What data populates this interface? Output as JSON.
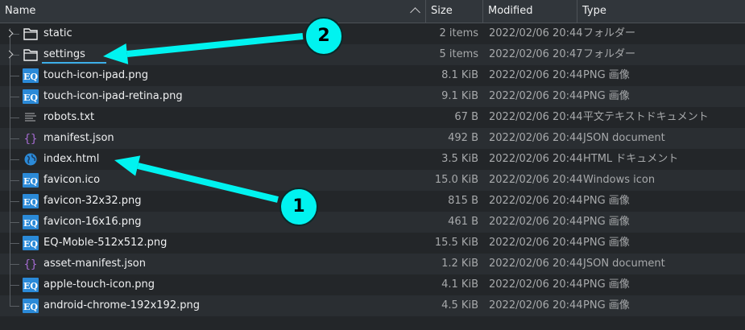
{
  "columns": {
    "name": "Name",
    "size": "Size",
    "modified": "Modified",
    "type": "Type"
  },
  "files": [
    {
      "name": "static",
      "size": "2 items",
      "modified": "2022/02/06 20:44",
      "type": "フォルダー",
      "icon": "folder-icon",
      "expandable": true
    },
    {
      "name": "settings",
      "size": "5 items",
      "modified": "2022/02/06 20:47",
      "type": "フォルダー",
      "icon": "folder-icon",
      "expandable": true,
      "editing": true
    },
    {
      "name": "touch-icon-ipad.png",
      "size": "8.1 KiB",
      "modified": "2022/02/06 20:44",
      "type": "PNG 画像",
      "icon": "eq-image-icon"
    },
    {
      "name": "touch-icon-ipad-retina.png",
      "size": "9.1 KiB",
      "modified": "2022/02/06 20:44",
      "type": "PNG 画像",
      "icon": "eq-image-icon"
    },
    {
      "name": "robots.txt",
      "size": "67 B",
      "modified": "2022/02/06 20:44",
      "type": "平文テキストドキュメント",
      "icon": "text-file-icon"
    },
    {
      "name": "manifest.json",
      "size": "492 B",
      "modified": "2022/02/06 20:44",
      "type": "JSON document",
      "icon": "json-file-icon"
    },
    {
      "name": "index.html",
      "size": "3.5 KiB",
      "modified": "2022/02/06 20:44",
      "type": "HTML ドキュメント",
      "icon": "globe-html-icon"
    },
    {
      "name": "favicon.ico",
      "size": "15.0 KiB",
      "modified": "2022/02/06 20:44",
      "type": "Windows icon",
      "icon": "eq-image-icon"
    },
    {
      "name": "favicon-32x32.png",
      "size": "815 B",
      "modified": "2022/02/06 20:44",
      "type": "PNG 画像",
      "icon": "eq-image-icon"
    },
    {
      "name": "favicon-16x16.png",
      "size": "461 B",
      "modified": "2022/02/06 20:44",
      "type": "PNG 画像",
      "icon": "eq-image-icon"
    },
    {
      "name": "EQ-Moble-512x512.png",
      "size": "15.5 KiB",
      "modified": "2022/02/06 20:44",
      "type": "PNG 画像",
      "icon": "eq-image-icon"
    },
    {
      "name": "asset-manifest.json",
      "size": "1.2 KiB",
      "modified": "2022/02/06 20:44",
      "type": "JSON document",
      "icon": "json-file-icon"
    },
    {
      "name": "apple-touch-icon.png",
      "size": "4.1 KiB",
      "modified": "2022/02/06 20:44",
      "type": "PNG 画像",
      "icon": "eq-image-icon"
    },
    {
      "name": "android-chrome-192x192.png",
      "size": "4.5 KiB",
      "modified": "2022/02/06 20:44",
      "type": "PNG 画像",
      "icon": "eq-image-icon"
    }
  ],
  "callouts": [
    {
      "label": "1",
      "target": "index.html"
    },
    {
      "label": "2",
      "target": "settings"
    }
  ],
  "colors": {
    "accent": "#3daee9",
    "callout": "#00f3f0",
    "background": "#232629",
    "header": "#31363b"
  }
}
